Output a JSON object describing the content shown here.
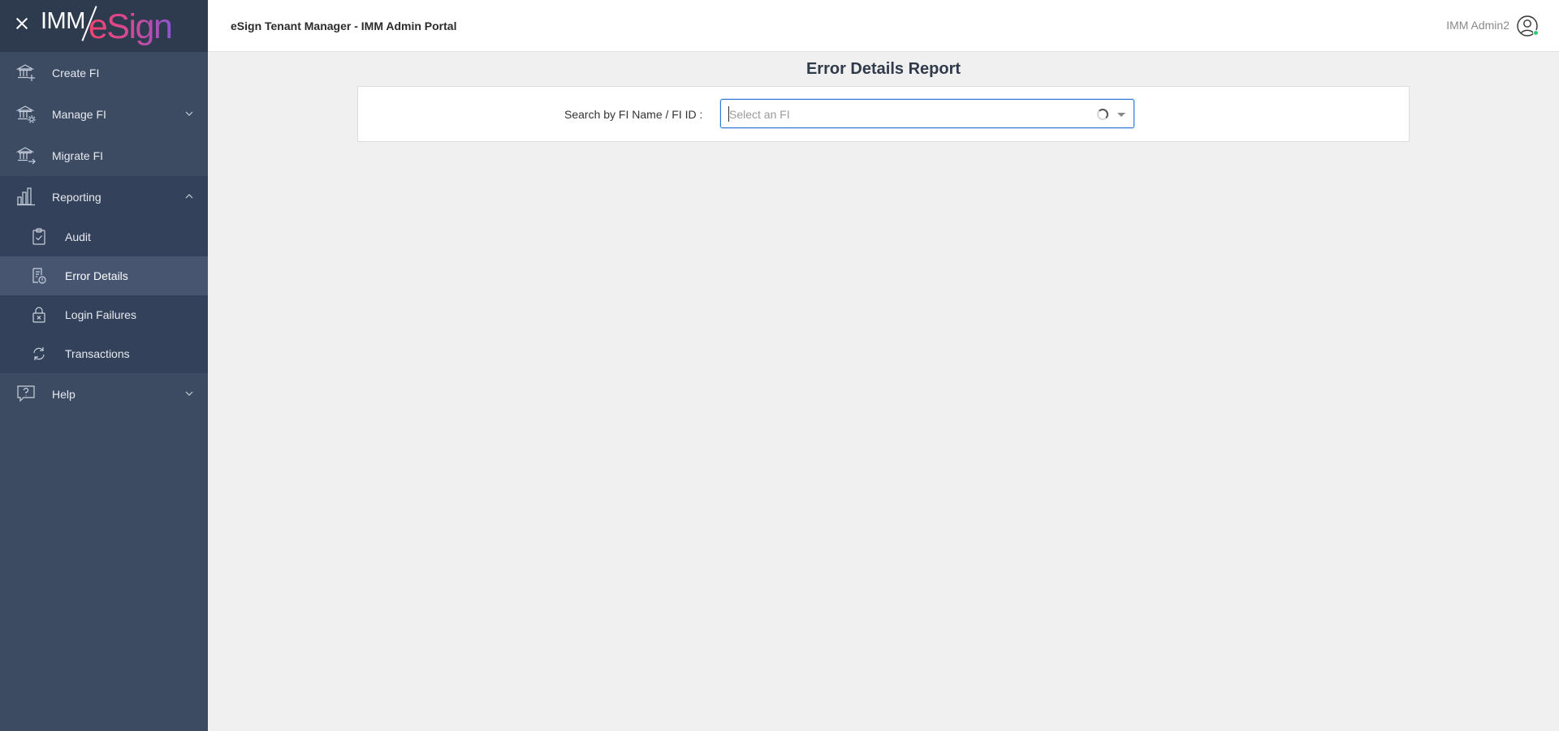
{
  "brand": {
    "logo_left": "IMM",
    "logo_right": "eSign"
  },
  "sidebar": {
    "items": [
      {
        "label": "Create FI",
        "icon": "bank-plus-icon"
      },
      {
        "label": "Manage FI",
        "icon": "bank-gear-icon",
        "expandable": true,
        "expanded": false
      },
      {
        "label": "Migrate FI",
        "icon": "bank-arrow-icon"
      },
      {
        "label": "Reporting",
        "icon": "bar-chart-icon",
        "expandable": true,
        "expanded": true,
        "children": [
          {
            "label": "Audit",
            "icon": "clipboard-check-icon"
          },
          {
            "label": "Error Details",
            "icon": "report-error-icon",
            "active": true
          },
          {
            "label": "Login Failures",
            "icon": "lock-x-icon"
          },
          {
            "label": "Transactions",
            "icon": "refresh-cycle-icon"
          }
        ]
      },
      {
        "label": "Help",
        "icon": "help-bubble-icon",
        "expandable": true,
        "expanded": false
      }
    ]
  },
  "header": {
    "title": "eSign Tenant Manager - IMM Admin Portal",
    "user_name": "IMM Admin2",
    "user_status": "online"
  },
  "main": {
    "page_title": "Error Details Report",
    "search": {
      "label": "Search by FI Name / FI ID :",
      "placeholder": "Select an FI",
      "loading": true
    }
  },
  "colors": {
    "sidebar_bg": "#3c4a62",
    "sidebar_header_bg": "#2e3a4e",
    "active_item_bg": "#475570",
    "focus_border": "#2b7bd6",
    "status_online": "#2ecc71"
  }
}
